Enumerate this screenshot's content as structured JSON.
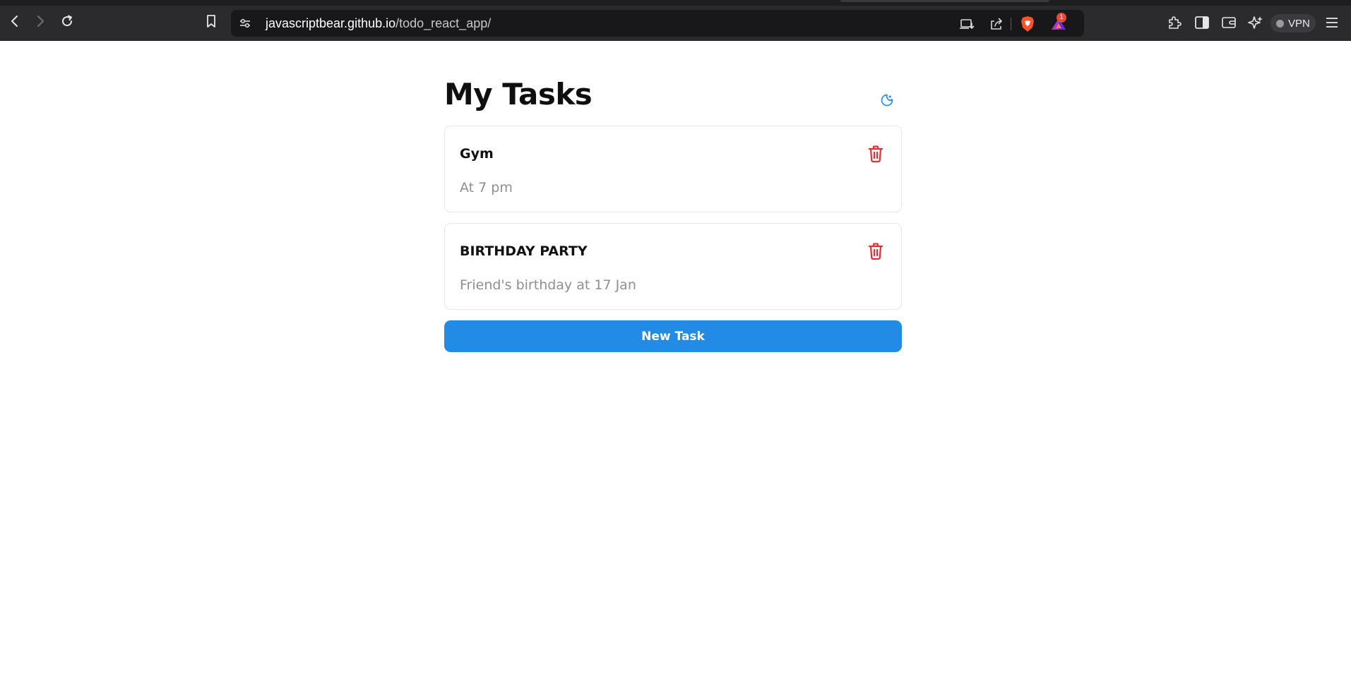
{
  "browser": {
    "url_host": "javascriptbear.github.io",
    "url_path": "/todo_react_app/",
    "shields_badge_count": "1",
    "vpn_label": "VPN",
    "icons": {
      "back": "back-arrow-icon",
      "forward": "forward-arrow-icon",
      "reload": "reload-icon",
      "bookmark": "bookmark-icon",
      "site_info": "site-settings-icon",
      "install": "install-app-icon",
      "share": "share-icon",
      "brave": "brave-shields-icon",
      "rewards": "brave-rewards-icon",
      "extensions": "extensions-icon",
      "sidebar": "sidebar-icon",
      "wallet": "wallet-icon",
      "leo": "leo-ai-icon",
      "menu": "hamburger-menu-icon"
    }
  },
  "app": {
    "title": "My Tasks",
    "theme_toggle_icon": "moon-icon",
    "accent_color": "#228be6",
    "danger_color": "#e03131",
    "tasks": [
      {
        "title": "Gym",
        "description": "At 7 pm"
      },
      {
        "title": "BIRTHDAY PARTY",
        "description": "Friend's birthday at 17 Jan"
      }
    ],
    "new_task_label": "New Task"
  }
}
